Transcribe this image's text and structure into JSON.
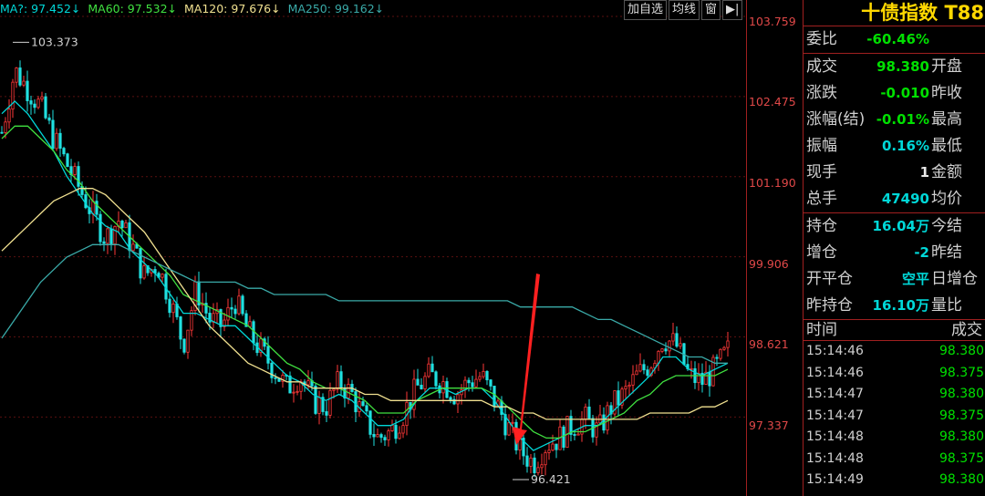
{
  "ma_legend": [
    {
      "label": "MA?: 97.452↓",
      "color": "#00d8d8"
    },
    {
      "label": "MA60: 97.532↓",
      "color": "#40e040"
    },
    {
      "label": "MA120: 97.676↓",
      "color": "#f0e090"
    },
    {
      "label": "MA250: 99.162↓",
      "color": "#3aaaa8"
    }
  ],
  "toolbar": {
    "add_watch": "加自选",
    "ma_toggle": "均线",
    "window": "窗",
    "exit": "▶|"
  },
  "price_axis": {
    "ticks": [
      "103.759",
      "102.475",
      "101.190",
      "99.906",
      "98.621",
      "97.337"
    ]
  },
  "annotations": {
    "high": "103.373",
    "low": "96.421"
  },
  "quote": {
    "title": "十债指数 T88",
    "rows": [
      {
        "label": "委比",
        "value": "-60.46%",
        "value_color": "green",
        "label2": ""
      },
      {
        "label": "成交",
        "value": "98.380",
        "value_color": "green",
        "label2": "开盘"
      },
      {
        "label": "涨跌",
        "value": "-0.010",
        "value_color": "green",
        "label2": "昨收"
      },
      {
        "label": "涨幅(结)",
        "value": "-0.01%",
        "value_color": "green",
        "label2": "最高"
      },
      {
        "label": "振幅",
        "value": "0.16%",
        "value_color": "cyan",
        "label2": "最低"
      },
      {
        "label": "现手",
        "value": "1",
        "value_color": "white",
        "label2": "金额"
      },
      {
        "label": "总手",
        "value": "47490",
        "value_color": "cyan",
        "label2": "均价"
      },
      {
        "label": "持仓",
        "value": "16.04万",
        "value_color": "cyan",
        "label2": "今结"
      },
      {
        "label": "增仓",
        "value": "-2",
        "value_color": "cyan",
        "label2": "昨结"
      },
      {
        "label": "开平仓",
        "value": "空平",
        "value_color": "cyan",
        "label2": "日增仓"
      },
      {
        "label": "昨持仓",
        "value": "16.10万",
        "value_color": "cyan",
        "label2": "量比"
      }
    ]
  },
  "trades": {
    "time_header": "时间",
    "price_header": "成交",
    "rows": [
      {
        "time": "15:14:46",
        "price": "98.380"
      },
      {
        "time": "15:14:46",
        "price": "98.375"
      },
      {
        "time": "15:14:47",
        "price": "98.380"
      },
      {
        "time": "15:14:47",
        "price": "98.375"
      },
      {
        "time": "15:14:48",
        "price": "98.380"
      },
      {
        "time": "15:14:48",
        "price": "98.375"
      },
      {
        "time": "15:14:49",
        "price": "98.380"
      }
    ]
  },
  "chart_data": {
    "type": "candlestick",
    "ylim": [
      96.421,
      103.759
    ],
    "high": 103.373,
    "low": 96.421,
    "close_path": [
      101.9,
      102.9,
      102.6,
      102.3,
      101.8,
      101.4,
      101.0,
      100.6,
      100.2,
      100.5,
      100.1,
      99.6,
      99.8,
      99.2,
      98.5,
      99.4,
      98.9,
      98.8,
      99.2,
      98.7,
      98.4,
      98.1,
      97.8,
      98.0,
      97.6,
      97.5,
      97.9,
      97.7,
      97.3,
      97.0,
      97.1,
      97.4,
      97.8,
      98.0,
      97.9,
      97.7,
      97.9,
      98.0,
      97.6,
      97.2,
      96.8,
      96.6,
      96.9,
      97.0,
      97.2,
      97.3,
      97.1,
      97.5,
      97.7,
      98.0,
      98.2,
      98.6,
      98.5,
      98.0,
      97.9,
      98.1,
      98.4
    ],
    "ma_lines": [
      {
        "name": "MA?",
        "color": "#00d8d8",
        "values": [
          102.2,
          102.4,
          102.2,
          101.9,
          101.6,
          101.2,
          100.9,
          100.6,
          100.4,
          100.3,
          100.0,
          99.8,
          99.6,
          99.3,
          99.0,
          99.0,
          98.9,
          98.8,
          98.8,
          98.6,
          98.4,
          98.2,
          98.0,
          97.9,
          97.7,
          97.6,
          97.7,
          97.6,
          97.4,
          97.2,
          97.2,
          97.3,
          97.6,
          97.8,
          97.8,
          97.7,
          97.8,
          97.8,
          97.6,
          97.3,
          97.0,
          96.8,
          96.9,
          97.0,
          97.1,
          97.2,
          97.2,
          97.4,
          97.6,
          97.8,
          98.0,
          98.3,
          98.3,
          98.1,
          98.0,
          98.1,
          98.2
        ]
      },
      {
        "name": "MA60",
        "color": "#40e040",
        "values": [
          101.8,
          102.0,
          102.0,
          101.8,
          101.6,
          101.3,
          101.1,
          100.8,
          100.6,
          100.4,
          100.2,
          100.0,
          99.8,
          99.6,
          99.3,
          99.2,
          99.1,
          99.0,
          98.9,
          98.8,
          98.6,
          98.4,
          98.2,
          98.1,
          97.9,
          97.8,
          97.8,
          97.7,
          97.6,
          97.4,
          97.4,
          97.4,
          97.6,
          97.7,
          97.8,
          97.8,
          97.8,
          97.8,
          97.7,
          97.5,
          97.3,
          97.1,
          97.0,
          97.0,
          97.1,
          97.1,
          97.2,
          97.3,
          97.4,
          97.6,
          97.7,
          97.9,
          98.0,
          98.0,
          98.0,
          98.0,
          98.1
        ]
      },
      {
        "name": "MA120",
        "color": "#f0e090",
        "values": [
          100.0,
          100.2,
          100.4,
          100.6,
          100.8,
          100.9,
          101.0,
          101.0,
          100.9,
          100.7,
          100.5,
          100.3,
          100.0,
          99.7,
          99.4,
          99.1,
          98.8,
          98.6,
          98.4,
          98.2,
          98.1,
          98.0,
          97.9,
          97.9,
          97.8,
          97.8,
          97.8,
          97.8,
          97.7,
          97.7,
          97.6,
          97.6,
          97.6,
          97.6,
          97.6,
          97.6,
          97.6,
          97.6,
          97.5,
          97.5,
          97.4,
          97.4,
          97.3,
          97.3,
          97.3,
          97.3,
          97.3,
          97.3,
          97.3,
          97.3,
          97.4,
          97.4,
          97.4,
          97.4,
          97.5,
          97.5,
          97.6
        ]
      },
      {
        "name": "MA250",
        "color": "#3aaaa8",
        "values": [
          98.6,
          98.9,
          99.2,
          99.5,
          99.7,
          99.9,
          100.0,
          100.1,
          100.1,
          100.1,
          100.0,
          99.9,
          99.8,
          99.7,
          99.6,
          99.5,
          99.5,
          99.5,
          99.5,
          99.4,
          99.4,
          99.3,
          99.3,
          99.3,
          99.3,
          99.3,
          99.2,
          99.2,
          99.2,
          99.2,
          99.2,
          99.2,
          99.2,
          99.2,
          99.2,
          99.2,
          99.2,
          99.2,
          99.2,
          99.2,
          99.1,
          99.1,
          99.1,
          99.1,
          99.1,
          99.0,
          98.9,
          98.9,
          98.8,
          98.7,
          98.6,
          98.5,
          98.4,
          98.3,
          98.3,
          98.2,
          98.2
        ]
      }
    ]
  }
}
